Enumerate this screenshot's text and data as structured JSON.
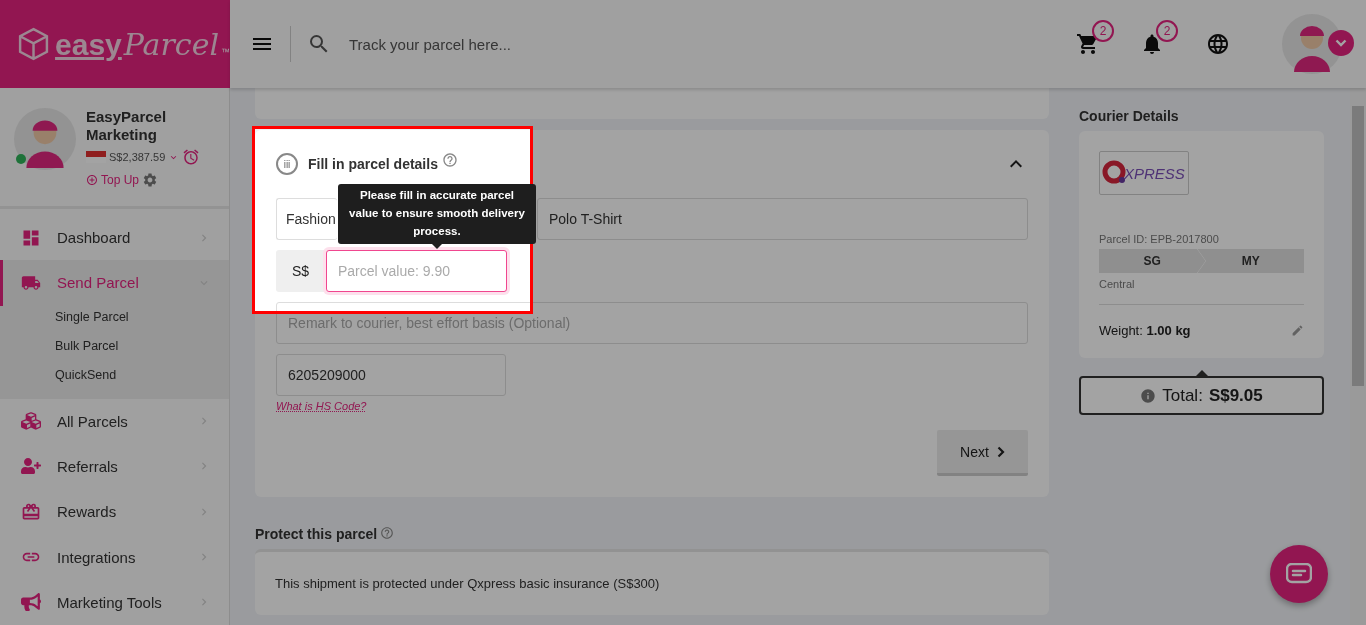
{
  "brand": {
    "bold": "easy",
    "script": "Parcel",
    "mark": "™"
  },
  "topbar": {
    "search_placeholder": "Track your parcel here...",
    "cart_count": "2",
    "notification_count": "2"
  },
  "user": {
    "name": "EasyParcel Marketing",
    "balance": "S$2,387.59",
    "top_up": "Top Up",
    "online": true
  },
  "nav": [
    {
      "label": "Dashboard",
      "selected": false,
      "expanded": false
    },
    {
      "label": "Send Parcel",
      "selected": true,
      "expanded": true,
      "children": [
        {
          "label": "Single Parcel"
        },
        {
          "label": "Bulk Parcel"
        },
        {
          "label": "QuickSend"
        }
      ]
    },
    {
      "label": "All Parcels",
      "selected": false,
      "expanded": false
    },
    {
      "label": "Referrals",
      "selected": false,
      "expanded": false
    },
    {
      "label": "Rewards",
      "selected": false,
      "expanded": false
    },
    {
      "label": "Integrations",
      "selected": false,
      "expanded": false
    },
    {
      "label": "Marketing Tools",
      "selected": false,
      "expanded": false
    }
  ],
  "parcel_form": {
    "step": "iii",
    "title": "Fill in parcel details",
    "expanded": true,
    "category": "Fashion",
    "description": "Polo T-Shirt",
    "currency": "S$",
    "value_placeholder": "Parcel value: 9.90",
    "value_focused": true,
    "remark_placeholder": "Remark to courier, best effort basis (Optional)",
    "hs_code": "6205209000",
    "hs_link": "What is HS Code?",
    "next": "Next"
  },
  "tooltip": "Please fill in accurate parcel value to ensure smooth delivery process.",
  "protection": {
    "title": "Protect this parcel",
    "text": "This shipment is protected under Qxpress basic insurance (S$300)"
  },
  "courier": {
    "title": "Courier Details",
    "logo_text": "XPRESS",
    "parcel_id": "Parcel ID: EPB-2017800",
    "from": "SG",
    "to": "MY",
    "area": "Central",
    "weight_label": "Weight:",
    "weight": "1.00 kg",
    "total_label": "Total:",
    "total": "S$9.05"
  }
}
